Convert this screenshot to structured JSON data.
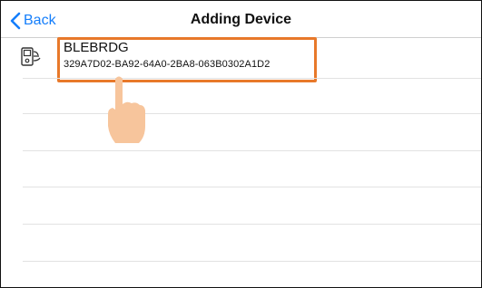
{
  "header": {
    "back_label": "Back",
    "title": "Adding Device"
  },
  "device": {
    "name": "BLEBRDG",
    "uuid": "329A7D02-BA92-64A0-2BA8-063B0302A1D2"
  },
  "icons": {
    "back": "chevron-left-icon",
    "device": "ble-bridge-device-icon",
    "hand": "pointing-hand-icon"
  },
  "colors": {
    "accent": "#147efb",
    "highlight": "#e8792a",
    "hand": "#f7c59c"
  }
}
